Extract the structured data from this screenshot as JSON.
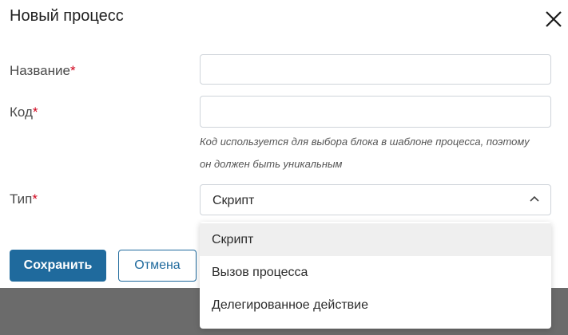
{
  "dialog": {
    "title": "Новый процесс",
    "close_icon": "close-icon"
  },
  "form": {
    "name": {
      "label": "Название",
      "required_mark": "*",
      "value": ""
    },
    "code": {
      "label": "Код",
      "required_mark": "*",
      "value": "",
      "hint_line1": "Код используется для выбора блока в шаблоне процесса, поэтому",
      "hint_line2": "он должен быть уникальным"
    },
    "type": {
      "label": "Тип",
      "required_mark": "*",
      "selected": "Скрипт",
      "chevron_icon": "chevron-up-icon"
    }
  },
  "dropdown": {
    "options": [
      "Скрипт",
      "Вызов процесса",
      "Делегированное действие"
    ],
    "selected_index": 0
  },
  "buttons": {
    "save": "Сохранить",
    "cancel": "Отмена"
  },
  "colors": {
    "primary": "#1f6a9d",
    "required": "#d0021b",
    "overlay": "#6b6b6b"
  }
}
